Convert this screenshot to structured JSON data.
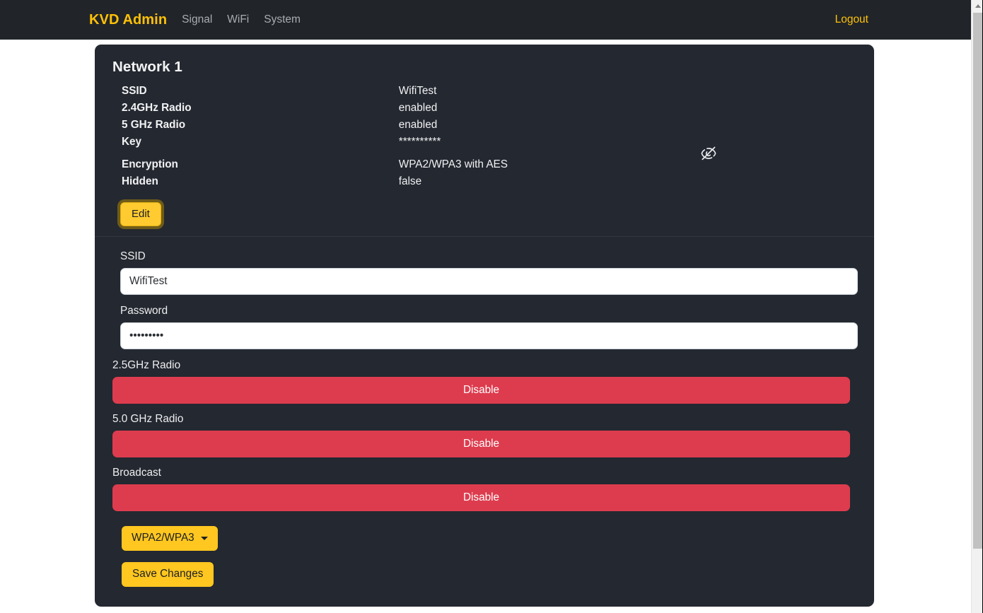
{
  "navbar": {
    "brand": "KVD Admin",
    "links": [
      {
        "label": "Signal"
      },
      {
        "label": "WiFi"
      },
      {
        "label": "System"
      }
    ],
    "logout": "Logout",
    "background_color": "#212529",
    "brand_color": "#ffc107"
  },
  "card": {
    "title": "Network 1",
    "info_rows": [
      {
        "key": "SSID",
        "value": "WifiTest"
      },
      {
        "key": "2.4GHz Radio",
        "value": "enabled"
      },
      {
        "key": "5 GHz Radio",
        "value": "enabled"
      },
      {
        "key": "Key",
        "value": "**********"
      },
      {
        "key": "Encryption",
        "value": "WPA2/WPA3 with AES"
      },
      {
        "key": "Hidden",
        "value": "false"
      }
    ],
    "toggle_key_visibility_icon": "eye-slash-icon",
    "edit_label": "Edit"
  },
  "form": {
    "ssid": {
      "label": "SSID",
      "value": "WifiTest",
      "placeholder": "SSID"
    },
    "password": {
      "label": "Password",
      "value": "•••••••••",
      "placeholder": "Password"
    },
    "radio_24": {
      "label": "2.5GHz Radio",
      "button_label": "Disable"
    },
    "radio_50": {
      "label": "5.0 GHz Radio",
      "button_label": "Disable"
    },
    "broadcast": {
      "label": "Broadcast",
      "button_label": "Disable"
    },
    "encryption_dropdown": {
      "selected": "WPA2/WPA3",
      "caret_icon": "chevron-down-icon"
    },
    "save_label": "Save Changes",
    "danger_color": "#dd3c4e",
    "accent_color": "#ffc720"
  },
  "scrollbar": {
    "up_arrow_icon": "chevron-up-icon"
  }
}
